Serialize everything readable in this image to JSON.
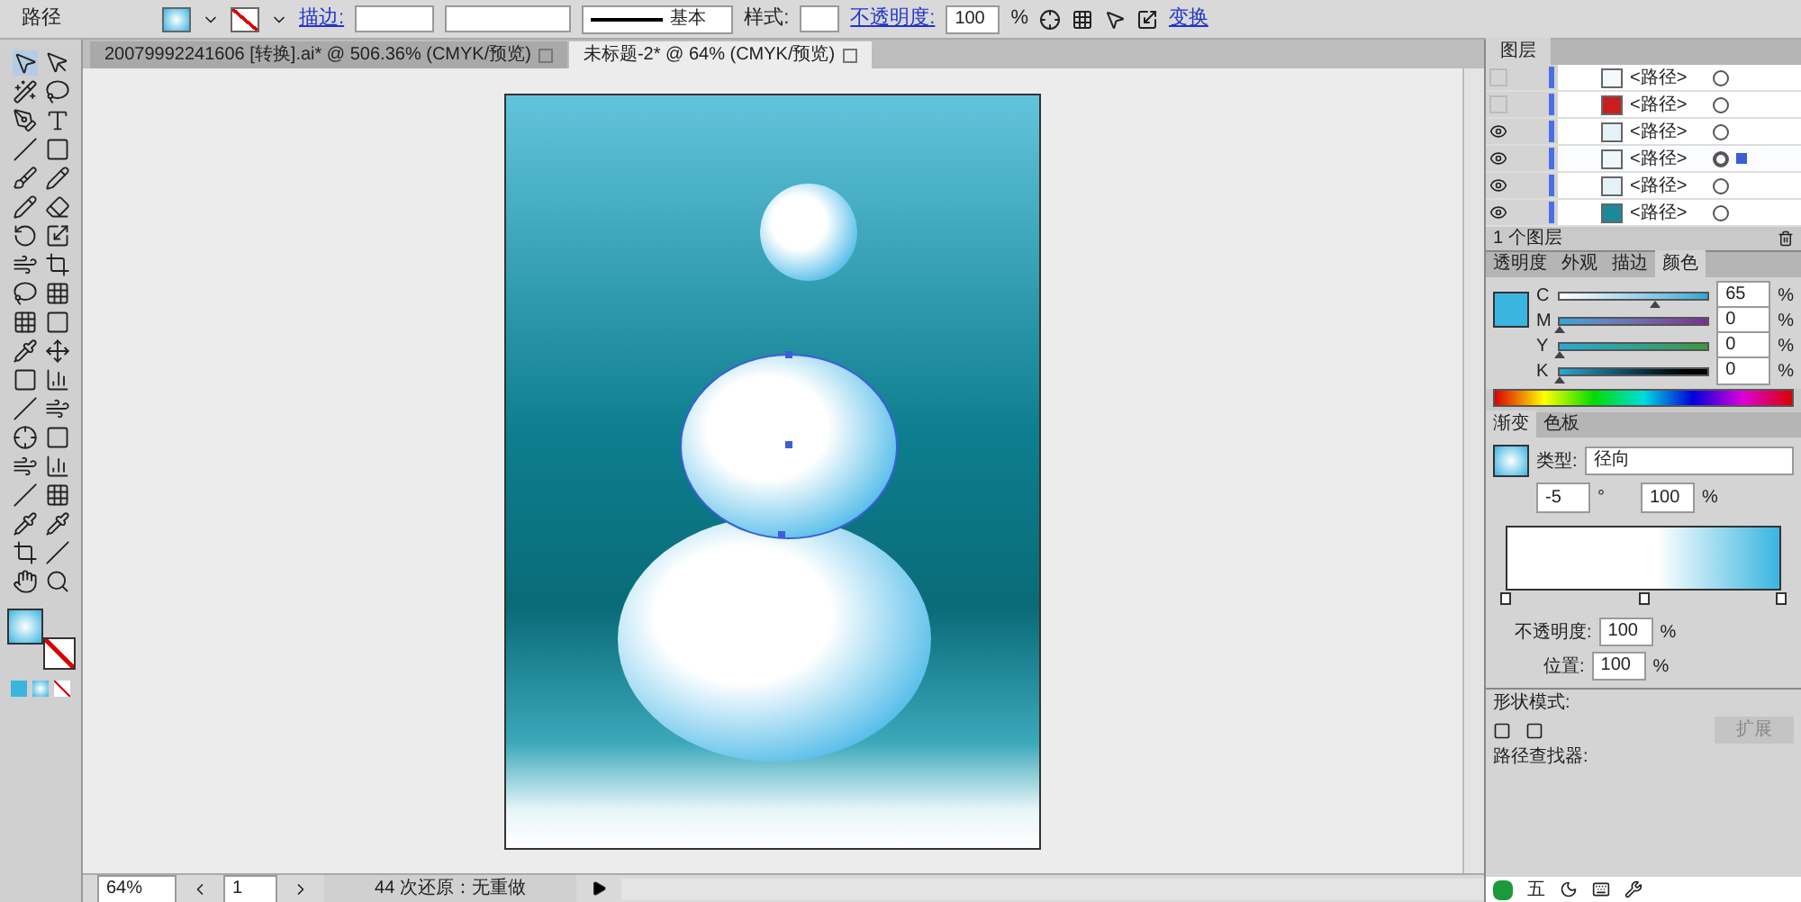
{
  "control_bar": {
    "selection": "路径",
    "stroke_label": "描边:",
    "stroke_profile": "基本",
    "style_label": "样式:",
    "opacity_label": "不透明度:",
    "opacity_value": "100",
    "opacity_unit": "%",
    "transform_link": "变换"
  },
  "doc_tabs": [
    {
      "label": "20079992241606 [转换].ai* @ 506.36% (CMYK/预览)",
      "selected": false
    },
    {
      "label": "未标题-2* @ 64% (CMYK/预览)",
      "selected": true
    }
  ],
  "layers_panel": {
    "title": "图层",
    "rows": [
      {
        "label": "<路径>",
        "visible": false,
        "selected": false,
        "color": "#f4fafc"
      },
      {
        "label": "<路径>",
        "visible": false,
        "selected": false,
        "color": "#c81e1e"
      },
      {
        "label": "<路径>",
        "visible": true,
        "selected": false,
        "color": "#e4f3f8"
      },
      {
        "label": "<路径>",
        "visible": true,
        "selected": true,
        "color": "#eef8fb"
      },
      {
        "label": "<路径>",
        "visible": true,
        "selected": false,
        "color": "#e4f3f8"
      },
      {
        "label": "<路径>",
        "visible": true,
        "selected": false,
        "color": "#1a8a9a"
      }
    ],
    "footer": "1 个图层"
  },
  "color_panel": {
    "tabs": [
      {
        "label": "透明度",
        "selected": false
      },
      {
        "label": "外观",
        "selected": false
      },
      {
        "label": "描边",
        "selected": false
      },
      {
        "label": "颜色",
        "selected": true
      }
    ],
    "channels": [
      {
        "name": "C",
        "value": "65",
        "level": 0.65
      },
      {
        "name": "M",
        "value": "0",
        "level": 0
      },
      {
        "name": "Y",
        "value": "0",
        "level": 0
      },
      {
        "name": "K",
        "value": "0",
        "level": 0
      }
    ],
    "unit": "%"
  },
  "gradient_panel": {
    "tabs": [
      {
        "label": "渐变",
        "selected": true
      },
      {
        "label": "色板",
        "selected": false
      }
    ],
    "type_label": "类型:",
    "type_value": "径向",
    "angle": "-5",
    "degree": "°",
    "aspect": "100",
    "aspect_unit": "%",
    "stops": [
      {
        "level": 0
      },
      {
        "level": 0.5
      },
      {
        "level": 1
      }
    ],
    "opacity_label": "不透明度:",
    "opacity_value": "100",
    "location_label": "位置:",
    "location_value": "100",
    "unit": "%"
  },
  "pathfinder_panel": {
    "shape_modes_label": "形状模式:",
    "expand_button": "扩展",
    "pathfinder_label": "路径查找器:"
  },
  "status_bar": {
    "zoom": "64%",
    "page": "1",
    "status": "44 次还原：无重做"
  },
  "ime_bar": {
    "mode": "五"
  }
}
